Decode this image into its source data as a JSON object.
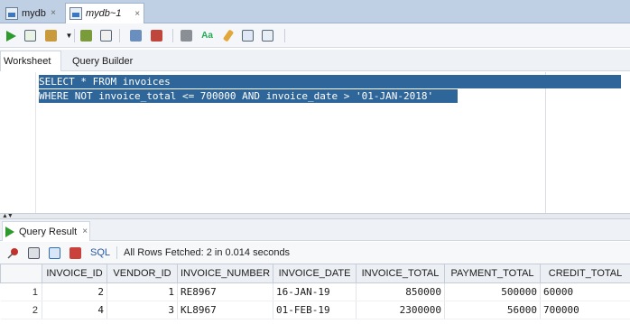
{
  "tabs": [
    {
      "label": "mydb",
      "close": "×"
    },
    {
      "label": "mydb~1",
      "close": "×"
    }
  ],
  "subtabs": {
    "worksheet": "Worksheet",
    "query_builder": "Query Builder"
  },
  "editor": {
    "lines": [
      "SELECT * FROM invoices",
      "WHERE NOT invoice_total <= 700000 AND invoice_date > '01-JAN-2018'"
    ]
  },
  "result": {
    "tab_label": "Query Result",
    "tab_close": "×",
    "sql_label": "SQL",
    "status": "All Rows Fetched: 2 in 0.014 seconds",
    "columns": [
      "INVOICE_ID",
      "VENDOR_ID",
      "INVOICE_NUMBER",
      "INVOICE_DATE",
      "INVOICE_TOTAL",
      "PAYMENT_TOTAL",
      "CREDIT_TOTAL"
    ],
    "rows": [
      {
        "num": "1",
        "cells": [
          "2",
          "1",
          "RE8967",
          "16-JAN-19",
          "850000",
          "500000",
          "60000"
        ]
      },
      {
        "num": "2",
        "cells": [
          "4",
          "3",
          "KL8967",
          "01-FEB-19",
          "2300000",
          "56000",
          "700000"
        ]
      }
    ]
  },
  "colors": {
    "accent": "#2f6699",
    "run_green": "#2d9a2d",
    "tabstrip": "#bfcfe4"
  }
}
